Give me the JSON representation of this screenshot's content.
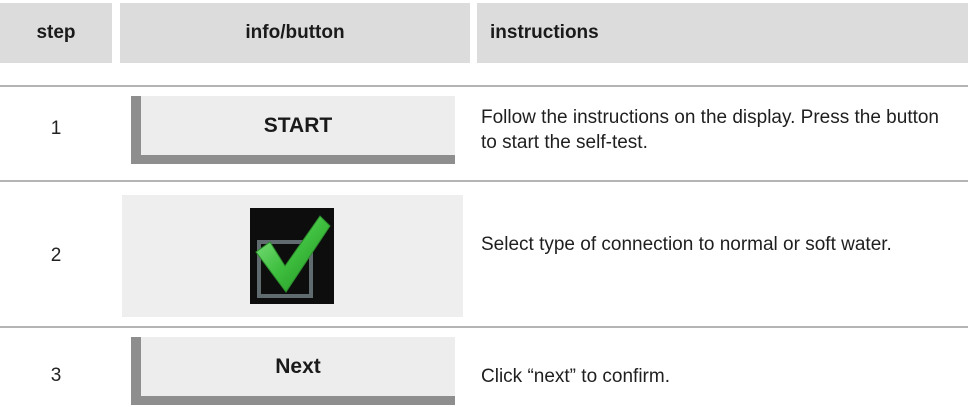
{
  "header": {
    "step": "step",
    "info_button": "info/button",
    "instructions": "instructions"
  },
  "steps": [
    {
      "number": "1",
      "button_label": "START",
      "instruction": "Follow the instructions on the display. Press the button to start the self-test."
    },
    {
      "number": "2",
      "icon": "checkmark-icon",
      "instruction": "Select type of connection to normal or soft water."
    },
    {
      "number": "3",
      "button_label": "Next",
      "instruction": "Click “next” to confirm."
    }
  ],
  "colors": {
    "header_bg": "#dcdcdc",
    "button_bg": "#ededed",
    "button_shadow": "#8e8e8e",
    "divider": "#b4b4b4",
    "check_green": "#3fbf3f",
    "check_box_bg": "#0d0d0d"
  }
}
